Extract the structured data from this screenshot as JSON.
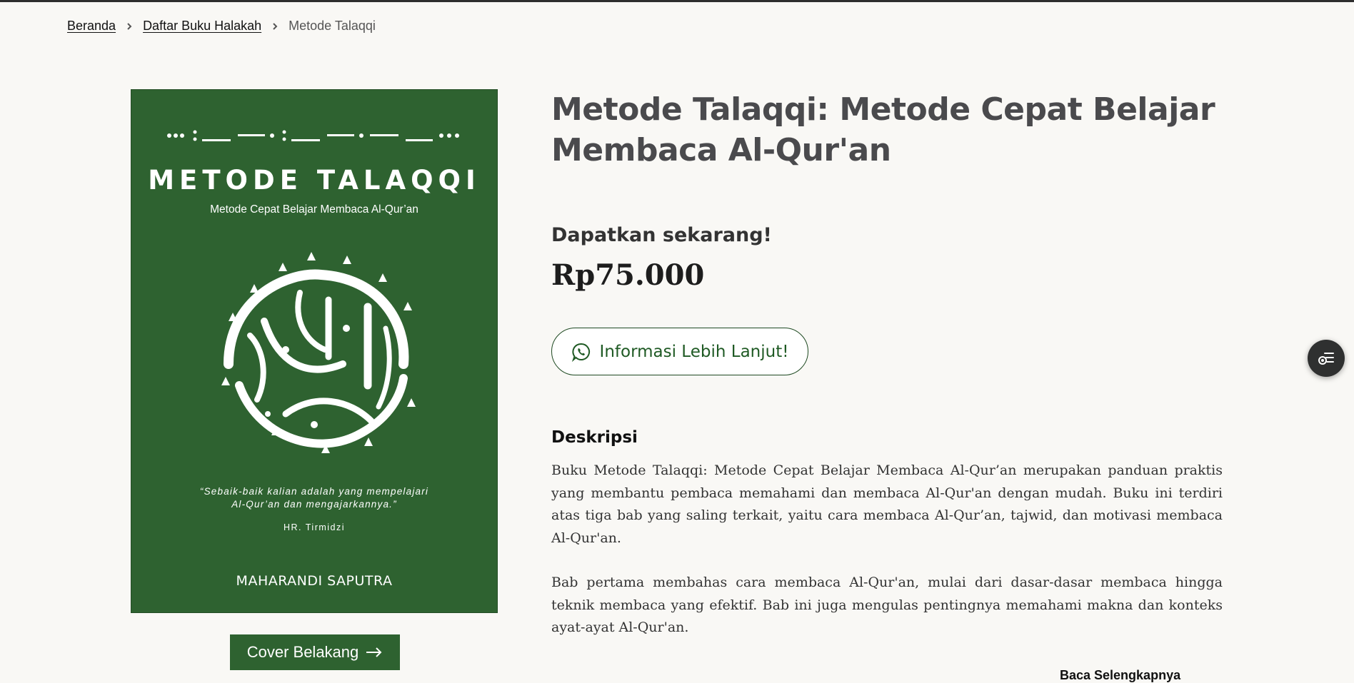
{
  "breadcrumb": {
    "home": "Beranda",
    "list": "Daftar Buku Halakah",
    "current": "Metode Talaqqi"
  },
  "cover": {
    "title": "METODE TALAQQI",
    "subtitle": "Metode Cepat Belajar Membaca Al-Qur’an",
    "quote_line1": "“Sebaik-baik kalian adalah yang mempelajari",
    "quote_line2": "Al-Qur’an dan mengajarkannya.”",
    "source": "HR. Tirmidzi",
    "author": "MAHARANDI SAPUTRA",
    "background_color": "#2e6230"
  },
  "back_cover_button": {
    "label": "Cover Belakang",
    "icon": "arrow-right-icon"
  },
  "product": {
    "title": "Metode Talaqqi: Metode Cepat Belajar Membaca Al-Qur'an",
    "cta_heading": "Dapatkan sekarang!",
    "price": "Rp75.000",
    "info_button": {
      "label": "Informasi Lebih Lanjut!",
      "icon": "whatsapp-icon"
    }
  },
  "description": {
    "heading": "Deskripsi",
    "paragraphs": [
      "Buku Metode Talaqqi: Metode Cepat Belajar Membaca Al-Qur’an merupakan panduan praktis yang membantu pembaca memahami dan membaca Al-Qur'an dengan mudah. Buku ini terdiri atas tiga bab yang saling terkait, yaitu cara membaca Al-Qur’an, tajwid, dan motivasi membaca Al-Qur'an.",
      "Bab pertama membahas cara membaca Al-Qur'an, mulai dari dasar-dasar membaca hingga teknik membaca yang efektif. Bab ini juga mengulas pentingnya memahami makna dan konteks ayat-ayat Al-Qur'an."
    ],
    "read_more": "Baca Selengkapnya"
  },
  "floating_button": {
    "icon": "reading-list-icon"
  },
  "colors": {
    "accent": "#2e6230",
    "title": "#4a4a4d",
    "background": "#f9f8f5"
  }
}
